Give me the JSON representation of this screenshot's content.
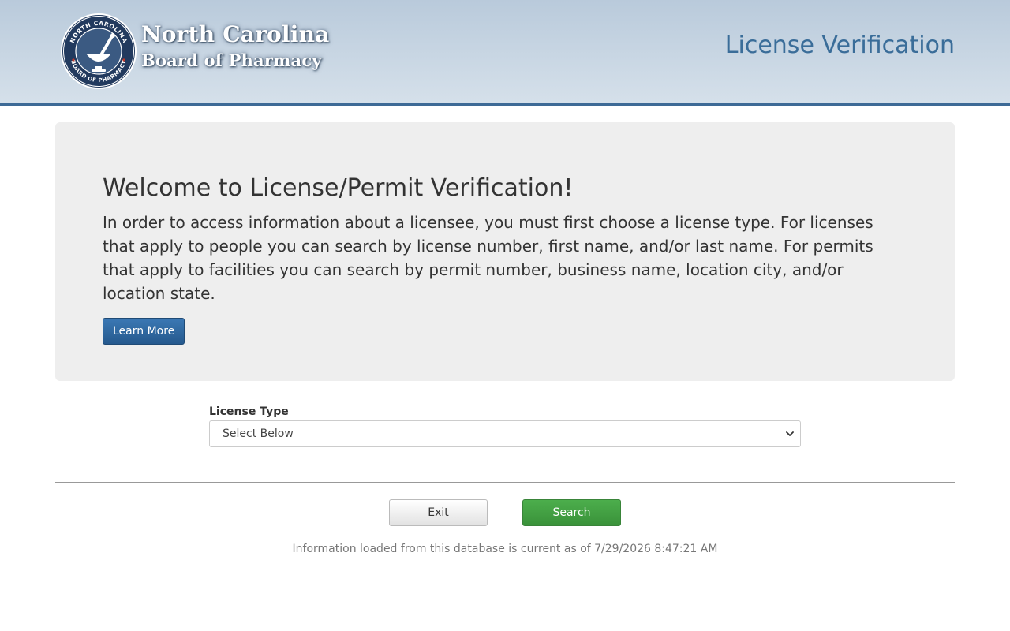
{
  "header": {
    "org_line1": "North Carolina",
    "org_line2": "Board of Pharmacy",
    "seal_top_text": "NORTH CAROLINA",
    "seal_bottom_text": "BOARD OF PHARMACY",
    "page_title": "License Verification",
    "logo_icon": "pharmacy-seal-icon",
    "colors": {
      "banner_top": "#b9cadb",
      "banner_bottom": "#d5e0ea",
      "banner_border": "#3d6a96",
      "title": "#3a6d99"
    }
  },
  "welcome": {
    "heading": "Welcome to License/Permit Verification!",
    "body": "In order to access information about a licensee, you must first choose a license type. For licenses that apply to people you can search by license number, first name, and/or last name. For permits that apply to facilities you can search by permit number, business name, location city, and/or location state.",
    "learn_more_label": "Learn More"
  },
  "form": {
    "license_type_label": "License Type",
    "license_type_selected": "Select Below",
    "chevron_icon": "chevron-down-icon"
  },
  "actions": {
    "exit_label": "Exit",
    "search_label": "Search",
    "colors": {
      "search": "#449d44",
      "learn_more": "#2e6aa3"
    }
  },
  "footer": {
    "note": "Information loaded from this database is current as of 7/29/2026 8:47:21 AM"
  }
}
